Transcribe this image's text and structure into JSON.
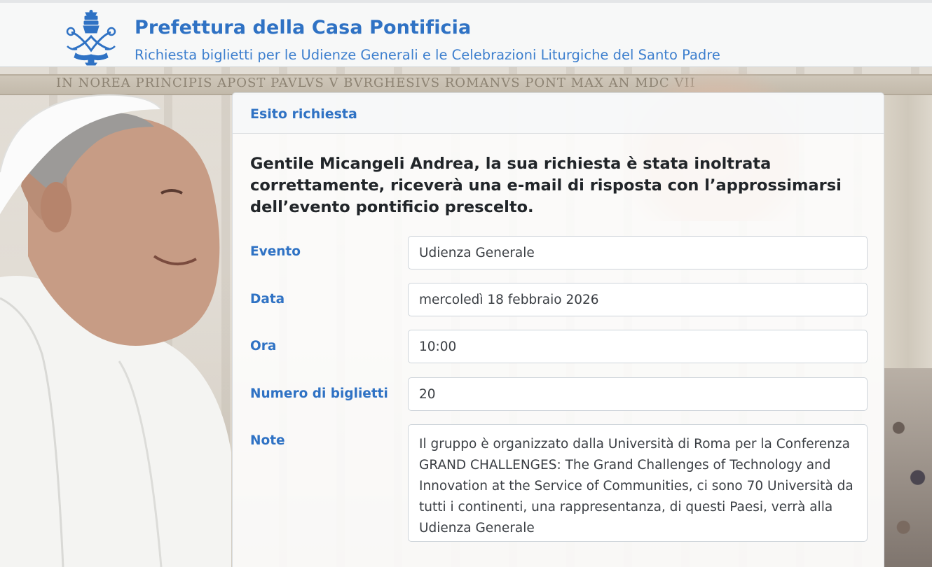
{
  "header": {
    "title": "Prefettura della Casa Pontificia",
    "subtitle": "Richiesta biglietti per le Udienze Generali e le Celebrazioni Liturgiche del Santo Padre",
    "emblem_icon": "papal-coat-of-arms-icon"
  },
  "background": {
    "inscription": "IN NOREA PRINCIPIS APOST PAVLVS V BVRGHESIVS ROMANVS PONT MAX AN MDC VII"
  },
  "card": {
    "title": "Esito richiesta",
    "message": "Gentile Micangeli Andrea, la sua richiesta è stata inoltrata correttamente, riceverà una e-mail di risposta con l’approssimarsi dell’evento pontificio prescelto.",
    "fields": [
      {
        "label": "Evento",
        "value": "Udienza Generale"
      },
      {
        "label": "Data",
        "value": "mercoledì 18 febbraio 2026"
      },
      {
        "label": "Ora",
        "value": "10:00"
      },
      {
        "label": "Numero di biglietti",
        "value": "20"
      },
      {
        "label": "Note",
        "value": "Il gruppo è organizzato dalla Università di Roma per la Conferenza\nGRAND CHALLENGES: The Grand Challenges of Technology and\nInnovation at the Service of Communities, ci sono 70 Università da\ntutti i continenti, una rappresentanza, di questi Paesi, verrà alla\nUdienza Generale"
      }
    ]
  },
  "colors": {
    "accent": "#2f72c4",
    "text": "#212529",
    "field_border": "#ced4da"
  }
}
